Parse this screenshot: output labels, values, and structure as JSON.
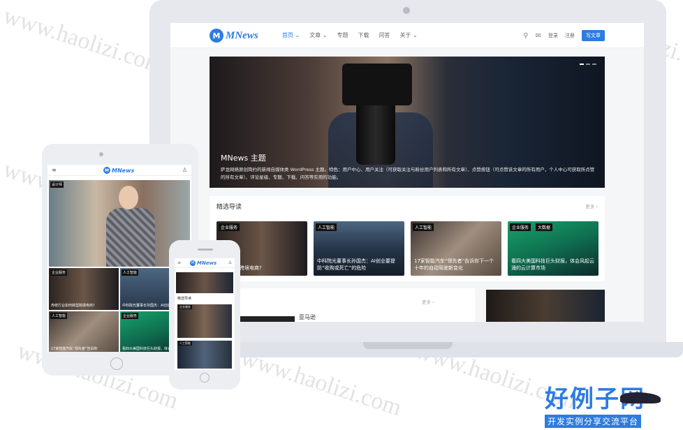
{
  "laptop": {
    "logo": {
      "mark": "M",
      "text": "MNews"
    },
    "menu": [
      "首页 ⌄",
      "文章 ⌄",
      "专题",
      "下载",
      "问答",
      "关于 ⌄"
    ],
    "nav_right": {
      "login": "登录",
      "register": "注册",
      "write": "写文章"
    },
    "hero": {
      "title": "MNews 主题",
      "desc": "萨龙网络原创简约的新闻自媒体类 WordPress 主题。特色：用户中心、用户关注（可获取关注与粉丝用户列表和所有文章）、点赞按钮（可点赞该文章的所有用户，个人中心可获取所点赞的所有文章）、评论星级、专题、下载、问答等实用的功能。"
    },
    "featured": {
      "title": "精选导读",
      "more": "更多 ›",
      "cards": [
        {
          "tags": [
            "企业服务"
          ],
          "title": "如何转型跨境电商?"
        },
        {
          "tags": [
            "人工智能"
          ],
          "title": "中科院光董事长孙国杰：AI创业要提防“收购或死亡”的危险"
        },
        {
          "tags": [
            "人工智能"
          ],
          "title": "17家智能汽车“领先者”告诉你下一个十年的自动驾驶新变化"
        },
        {
          "tags": [
            "企业服务",
            "大数据"
          ],
          "title": "看四大美国科技巨头财报，体会风起云涌的云计算市场"
        }
      ]
    },
    "second_more": "更多 ›",
    "second_heading": "亚马逊"
  },
  "tablet": {
    "logo": {
      "mark": "M",
      "text": "MNews"
    },
    "menu_icon": "≡",
    "user_icon": "♙",
    "hero_tag": "设计师",
    "cells": [
      {
        "tag": "企业服务",
        "title": "传统行业如何转型跨境电商?"
      },
      {
        "tag": "人工智能",
        "title": "中科院光董事长孙国杰：AI创业要提防"
      },
      {
        "tag": "人工智能",
        "title": "17家智能汽车“领先者”告诉你"
      },
      {
        "tag": "企业服务",
        "title": "看四大美国科技巨头财报，体会风起"
      }
    ]
  },
  "phone": {
    "logo": {
      "mark": "M",
      "text": "MNews"
    },
    "menu_icon": "≡",
    "user_icon": "♙",
    "section": "精选导读",
    "tags": [
      "企业服务",
      "人工智能"
    ]
  },
  "watermark": "www.haolizi.com",
  "brand": {
    "big": "好例子网",
    "small": "开发实例分享交流平台"
  },
  "colors": {
    "accent": "#2d7ce0"
  }
}
